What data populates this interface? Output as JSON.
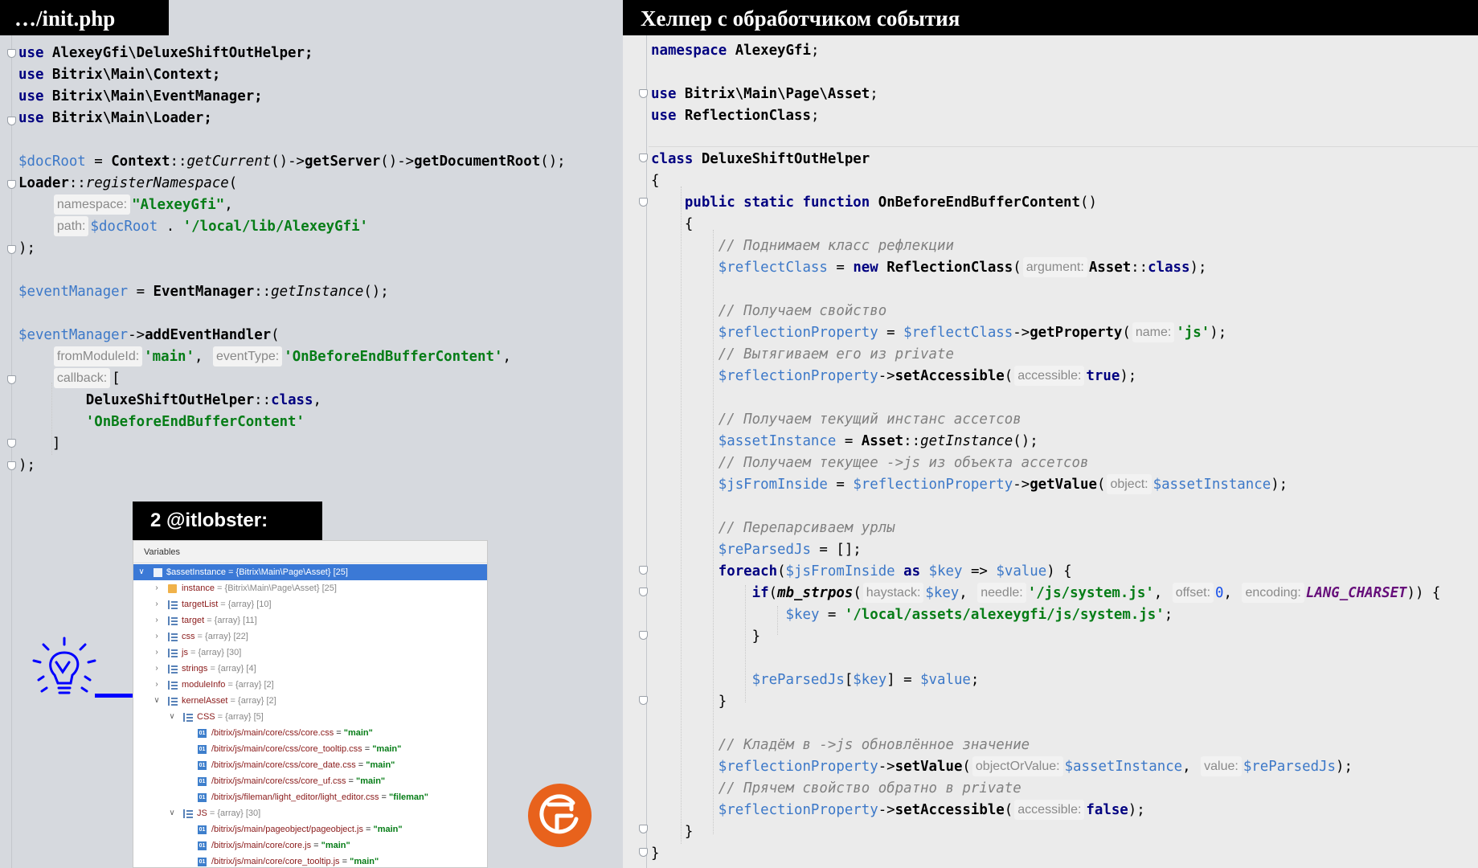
{
  "left": {
    "title": "…/init.php",
    "code_lines": [
      [
        "use AlexeyGfi\\DeluxeShiftOutHelper;"
      ],
      [
        "use Bitrix\\Main\\Context;"
      ],
      [
        "use Bitrix\\Main\\EventManager;"
      ],
      [
        "use Bitrix\\Main\\Loader;"
      ]
    ]
  },
  "right": {
    "title": "Хелпер с обработчиком события"
  },
  "badge": "2 @itlobster:",
  "debugger": {
    "header": "Variables",
    "rows": [
      {
        "name": "$assetInstance",
        "value": " = {Bitrix\\Main\\Page\\Asset} [25]"
      },
      {
        "name": "instance",
        "value": " = {Bitrix\\Main\\Page\\Asset} [25]"
      },
      {
        "name": "targetList",
        "value": " = {array} [10]"
      },
      {
        "name": "target",
        "value": " = {array} [11]"
      },
      {
        "name": "css",
        "value": " = {array} [22]"
      },
      {
        "name": "js",
        "value": " = {array} [30]"
      },
      {
        "name": "strings",
        "value": " = {array} [4]"
      },
      {
        "name": "moduleInfo",
        "value": " = {array} [2]"
      },
      {
        "name": "kernelAsset",
        "value": " = {array} [2]"
      },
      {
        "name": "CSS",
        "value": " = {array} [5]"
      },
      {
        "name": "/bitrix/js/main/core/css/core.css",
        "value": "\"main\""
      },
      {
        "name": "/bitrix/js/main/core/css/core_tooltip.css",
        "value": "\"main\""
      },
      {
        "name": "/bitrix/js/main/core/css/core_date.css",
        "value": "\"main\""
      },
      {
        "name": "/bitrix/js/main/core/css/core_uf.css",
        "value": "\"main\""
      },
      {
        "name": "/bitrix/js/fileman/light_editor/light_editor.css",
        "value": "\"fileman\""
      },
      {
        "name": "JS",
        "value": " = {array} [30]"
      },
      {
        "name": "/bitrix/js/main/pageobject/pageobject.js",
        "value": "\"main\""
      },
      {
        "name": "/bitrix/js/main/core/core.js",
        "value": "\"main\""
      },
      {
        "name": "/bitrix/js/main/core/core_tooltip.js",
        "value": "\"main\""
      }
    ]
  },
  "colors": {
    "left_bg": "#d6d9de",
    "right_bg": "#ebebeb",
    "keyword": "#000080",
    "string": "#067d17",
    "variable": "#3c78c8",
    "comment": "#808080",
    "selection": "#3b79d6",
    "logo": "#e8621c",
    "annotation": "#0000ff"
  }
}
